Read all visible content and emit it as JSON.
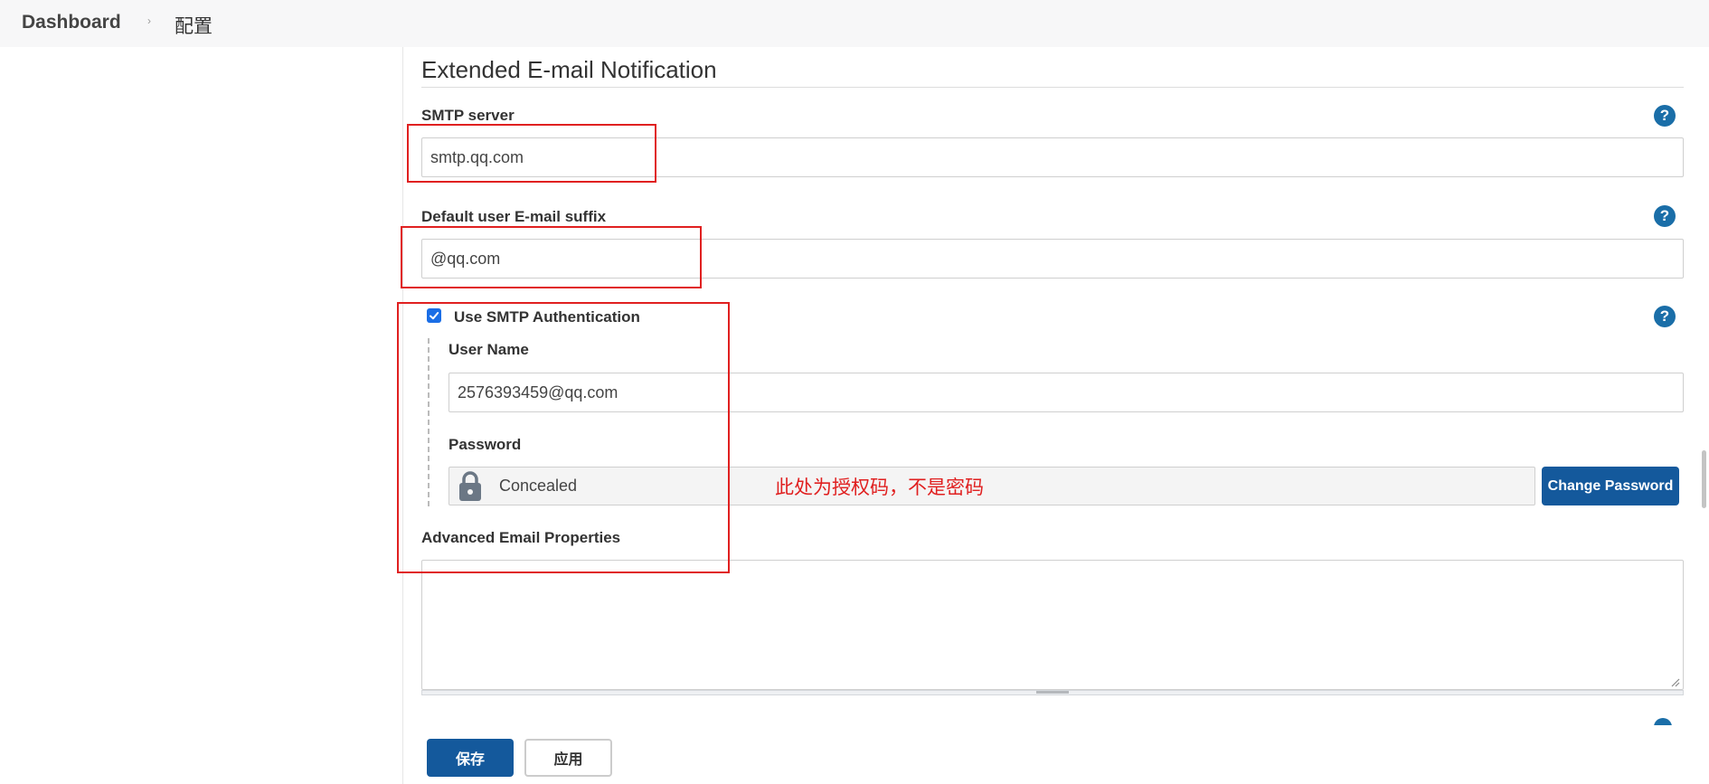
{
  "breadcrumb": {
    "dashboard": "Dashboard",
    "separator": "›",
    "current": "配置"
  },
  "section": {
    "title": "Extended E-mail Notification"
  },
  "smtp": {
    "label": "SMTP server",
    "value": "smtp.qq.com"
  },
  "suffix": {
    "label": "Default user E-mail suffix",
    "value": "@qq.com"
  },
  "auth": {
    "checkbox_label": "Use SMTP Authentication",
    "checked": true,
    "username_label": "User Name",
    "username_value": "2576393459@qq.com",
    "password_label": "Password",
    "password_value": "Concealed",
    "change_password_label": "Change Password"
  },
  "advanced": {
    "label": "Advanced Email Properties",
    "value": ""
  },
  "help_icon": "?",
  "annotation": {
    "note": "此处为授权码，不是密码",
    "color": "#e02020"
  },
  "actions": {
    "save_label": "保存",
    "apply_label": "应用"
  },
  "colors": {
    "primary_button": "#14599c",
    "help_icon": "#1a6ea8",
    "checkbox": "#1a6ee6"
  }
}
